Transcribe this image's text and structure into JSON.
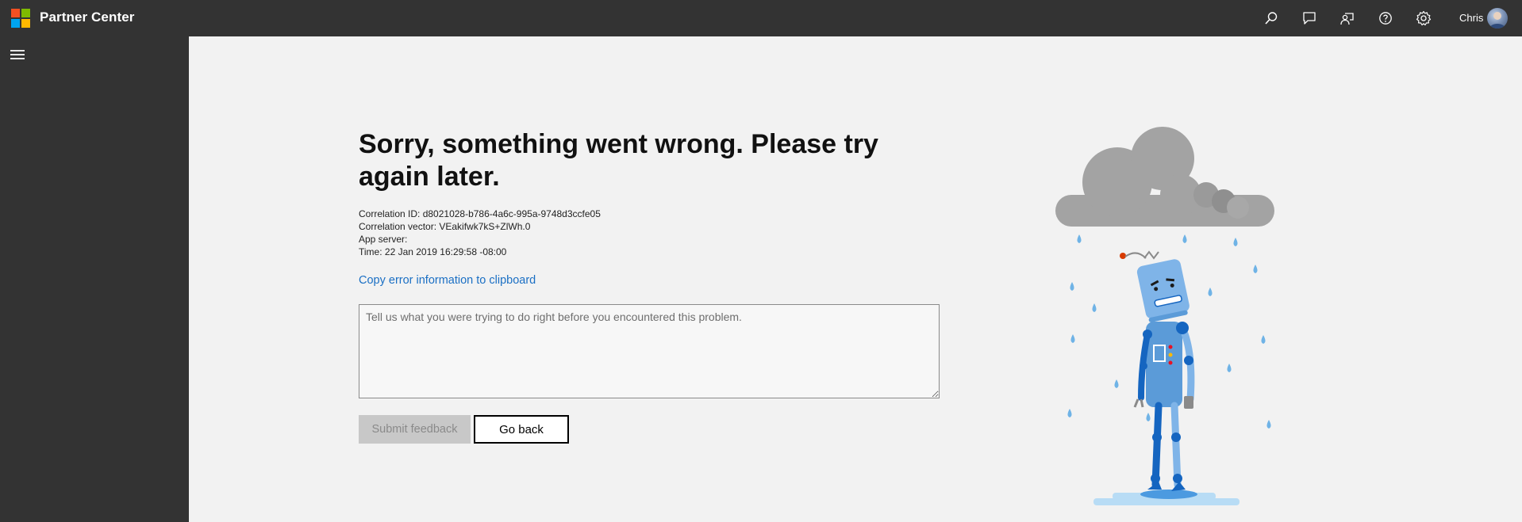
{
  "header": {
    "app_title": "Partner Center",
    "user_name": "Chris",
    "icons": [
      "search-icon",
      "chat-icon",
      "feedback-icon",
      "help-icon",
      "settings-icon"
    ]
  },
  "sidebar": {
    "menu_icon": "hamburger-menu-icon"
  },
  "error": {
    "title": "Sorry, something went wrong. Please try again later.",
    "correlation_id": "Correlation ID: d8021028-b786-4a6c-995a-9748d3ccfe05",
    "correlation_vector": "Correlation vector: VEakifwk7kS+ZlWh.0",
    "app_server": "App server:",
    "time": "Time: 22 Jan 2019 16:29:58 -08:00",
    "copy_link": "Copy error information to clipboard"
  },
  "feedback": {
    "placeholder": "Tell us what you were trying to do right before you encountered this problem.",
    "value": ""
  },
  "buttons": {
    "submit_label": "Submit feedback",
    "back_label": "Go back"
  },
  "colors": {
    "topbar": "#333333",
    "background": "#f2f2f2",
    "link": "#1a6fc4",
    "robot_blue": "#7fb4e8",
    "robot_dark_blue": "#1565c0",
    "cloud_gray": "#a3a3a3",
    "rain_blue": "#6fb3e6"
  }
}
